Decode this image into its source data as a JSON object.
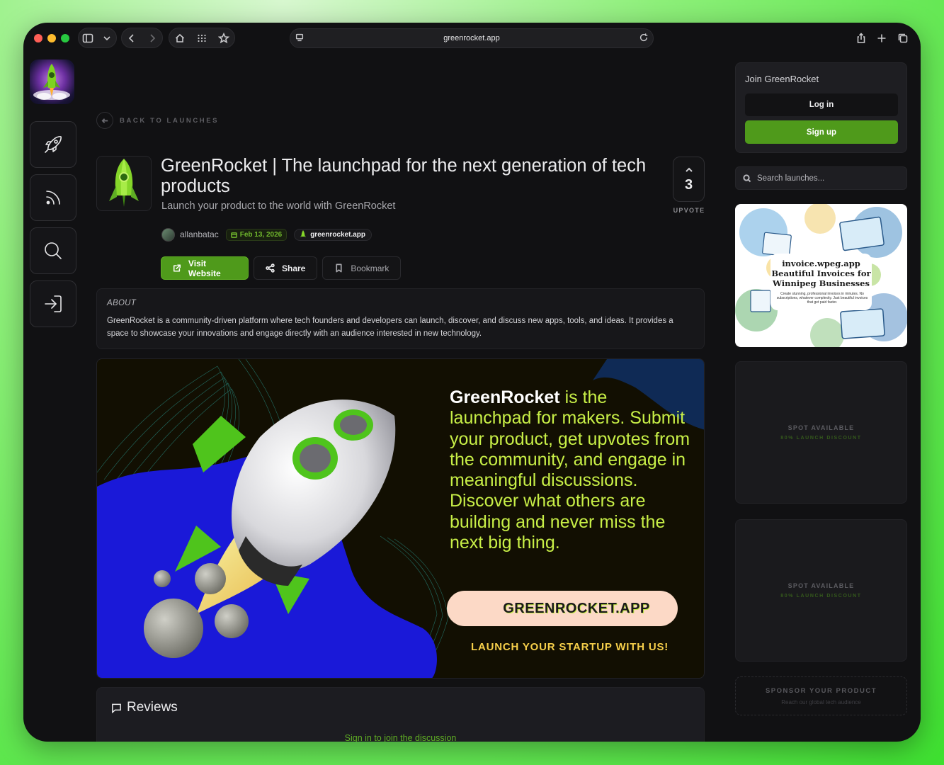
{
  "browser": {
    "url": "greenrocket.app"
  },
  "nav": {
    "back_label": "BACK TO LAUNCHES"
  },
  "product": {
    "title": "GreenRocket | The launchpad for the next generation of tech products",
    "tagline": "Launch your product to the world with GreenRocket",
    "author": "allanbatac",
    "date": "Feb 13, 2026",
    "website": "greenrocket.app",
    "upvotes": "3",
    "upvote_label": "UPVOTE",
    "buttons": {
      "visit": "Visit Website",
      "share": "Share",
      "bookmark": "Bookmark"
    }
  },
  "about": {
    "heading": "ABOUT",
    "text": "GreenRocket is a community-driven platform where tech founders and developers can launch, discover, and discuss new apps, tools, and ideas. It provides a space to showcase your innovations and engage directly with an audience interested in new technology."
  },
  "banner": {
    "brand": "GreenRocket",
    "text": "is the launchpad for makers. Submit your product, get upvotes from the community, and engage in meaningful discussions. Discover what others are building and never miss the next big thing.",
    "cta": "GREENROCKET.APP",
    "sub": "LAUNCH YOUR STARTUP WITH US!"
  },
  "reviews": {
    "heading": "Reviews",
    "signin": "Sign in to join the discussion"
  },
  "sidebar": {
    "join_title": "Join GreenRocket",
    "login": "Log in",
    "signup": "Sign up",
    "search_placeholder": "Search launches...",
    "ad": {
      "title": "invoice.wpeg.app",
      "subtitle": "Beautiful Invoices for Winnipeg Businesses",
      "desc": "Create stunning, professional invoices in minutes. No subscriptions, whatever complexity. Just beautiful invoices that get paid faster."
    },
    "spots": [
      {
        "title": "SPOT AVAILABLE",
        "sub": "80% LAUNCH DISCOUNT"
      },
      {
        "title": "SPOT AVAILABLE",
        "sub": "80% LAUNCH DISCOUNT"
      }
    ],
    "sponsor": {
      "title": "SPONSOR YOUR PRODUCT",
      "sub": "Reach our global tech audience"
    }
  },
  "colors": {
    "accent": "#4f9a1b",
    "background": "#111113",
    "banner_text": "#c8ef47"
  }
}
